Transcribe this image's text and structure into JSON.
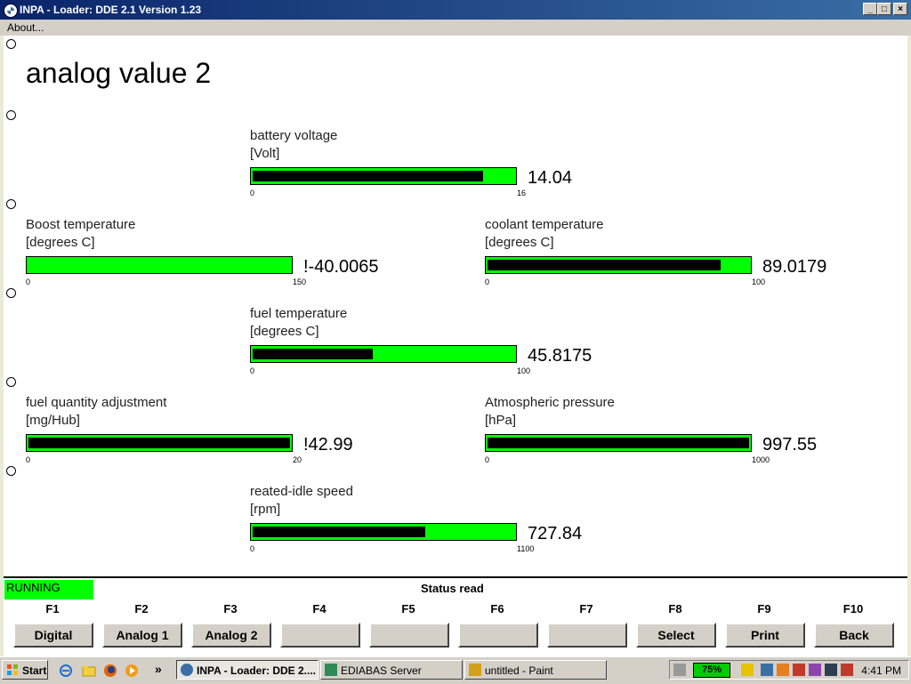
{
  "window": {
    "title": "INPA - Loader:  DDE 2.1 Version 1.23",
    "minimize": "_",
    "maximize": "□",
    "close": "×"
  },
  "menu": {
    "about": "About..."
  },
  "page": {
    "title": "analog value 2"
  },
  "gauges": {
    "battery": {
      "label": "battery voltage",
      "unit": "[Volt]",
      "min": "0",
      "max": "16",
      "value": "14.04",
      "fill_fraction": 0.88
    },
    "boost": {
      "label": "Boost temperature",
      "unit": "[degrees C]",
      "min": "0",
      "max": "150",
      "value": "!-40.0065",
      "fill_fraction": 0.0
    },
    "coolant": {
      "label": "coolant temperature",
      "unit": "[degrees C]",
      "min": "0",
      "max": "100",
      "value": "89.0179",
      "fill_fraction": 0.89
    },
    "fuel_temp": {
      "label": "fuel temperature",
      "unit": "[degrees C]",
      "min": "0",
      "max": "100",
      "value": "45.8175",
      "fill_fraction": 0.458
    },
    "fuel_qty": {
      "label": "fuel quantity adjustment",
      "unit": "[mg/Hub]",
      "min": "0",
      "max": "20",
      "value": "!42.99",
      "fill_fraction": 1.0
    },
    "atmo": {
      "label": "Atmospheric pressure",
      "unit": "[hPa]",
      "min": "0",
      "max": "1000",
      "value": "997.55",
      "fill_fraction": 1.0
    },
    "idle": {
      "label": "reated-idle speed",
      "unit": "[rpm]",
      "min": "0",
      "max": "1100",
      "value": "727.84",
      "fill_fraction": 0.66
    }
  },
  "status": {
    "running": "RUNNING",
    "message": "Status read",
    "running_color": "#00ff00"
  },
  "fkeys": [
    {
      "key": "F1",
      "label": "Digital"
    },
    {
      "key": "F2",
      "label": "Analog 1"
    },
    {
      "key": "F3",
      "label": "Analog 2"
    },
    {
      "key": "F4",
      "label": ""
    },
    {
      "key": "F5",
      "label": ""
    },
    {
      "key": "F6",
      "label": ""
    },
    {
      "key": "F7",
      "label": ""
    },
    {
      "key": "F8",
      "label": "Select"
    },
    {
      "key": "F9",
      "label": "Print"
    },
    {
      "key": "F10",
      "label": "Back"
    }
  ],
  "taskbar": {
    "start": "Start",
    "more": "»",
    "tasks": [
      {
        "label": "INPA - Loader:  DDE 2....",
        "icon": "bmw-icon"
      },
      {
        "label": "EDIABAS Server",
        "icon": "ediabas-icon"
      },
      {
        "label": "untitled - Paint",
        "icon": "paint-icon"
      }
    ],
    "battery": "75%",
    "clock": "4:41 PM"
  },
  "colors": {
    "gauge_bar": "#00ff00",
    "gauge_fill": "#000000",
    "titlebar": "#0a246a"
  }
}
